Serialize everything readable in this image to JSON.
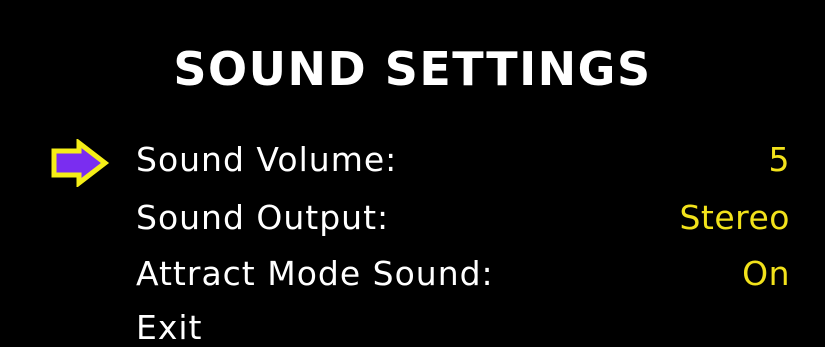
{
  "menu": {
    "title": "SOUND SETTINGS",
    "items": [
      {
        "label": "Sound Volume:",
        "value": "5",
        "selected": true
      },
      {
        "label": "Sound Output:",
        "value": "Stereo",
        "selected": false
      },
      {
        "label": "Attract Mode Sound:",
        "value": "On",
        "selected": false
      },
      {
        "label": "Exit",
        "value": "",
        "selected": false
      }
    ],
    "cursor_icon": "arrow-right-icon"
  },
  "colors": {
    "background": "#000000",
    "text": "#ffffff",
    "value_text": "#f2e21b",
    "cursor_fill": "#7a2df0",
    "cursor_outline": "#f5ee17"
  }
}
